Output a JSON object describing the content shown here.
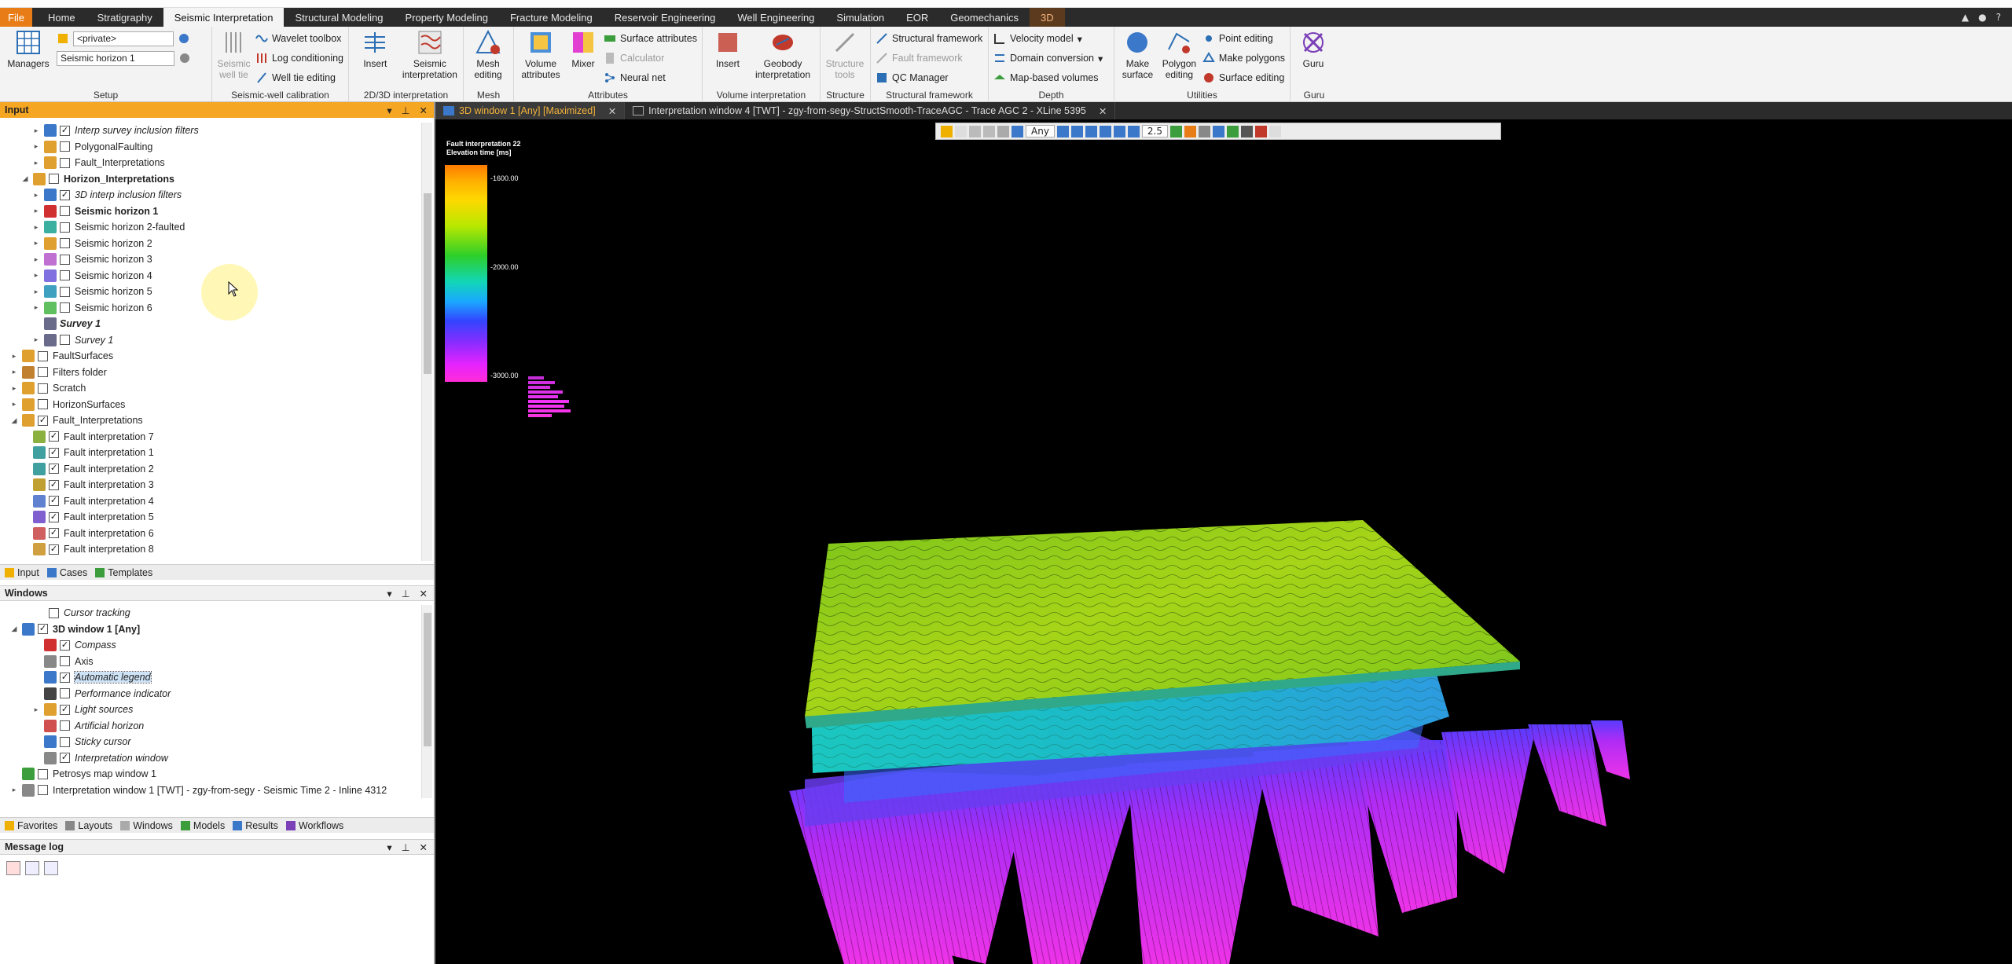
{
  "ribbon_tabs": [
    "File",
    "Home",
    "Stratigraphy",
    "Seismic Interpretation",
    "Structural Modeling",
    "Property Modeling",
    "Fracture Modeling",
    "Reservoir Engineering",
    "Well Engineering",
    "Simulation",
    "EOR",
    "Geomechanics",
    "3D"
  ],
  "active_tab": "Seismic Interpretation",
  "ribbon": {
    "setup": {
      "label": "Setup",
      "managers": "Managers",
      "private_combo": "<private>",
      "horizon_combo": "Seismic horizon 1"
    },
    "well_calibration": {
      "label": "Seismic-well calibration",
      "seismic_well_tie": "Seismic well tie",
      "wavelet_toolbox": "Wavelet toolbox",
      "log_conditioning": "Log conditioning",
      "well_tie_editing": "Well tie editing"
    },
    "interp_2d3d": {
      "label": "2D/3D interpretation",
      "insert": "Insert",
      "seismic_interpretation": "Seismic interpretation"
    },
    "mesh": {
      "label": "Mesh",
      "mesh_editing": "Mesh editing"
    },
    "attributes": {
      "label": "Attributes",
      "volume_attributes": "Volume attributes",
      "mixer": "Mixer",
      "surface_attributes": "Surface attributes",
      "calculator": "Calculator",
      "neural_net": "Neural net"
    },
    "volume_interp": {
      "label": "Volume interpretation",
      "insert": "Insert",
      "geobody_interpretation": "Geobody interpretation"
    },
    "structure": {
      "label": "Structure",
      "structure_tools": "Structure tools"
    },
    "structural_framework": {
      "label": "Structural framework",
      "structural_framework": "Structural framework",
      "fault_framework": "Fault framework",
      "qc_manager": "QC Manager"
    },
    "depth": {
      "label": "Depth",
      "velocity_model": "Velocity model",
      "domain_conversion": "Domain conversion",
      "map_based_volumes": "Map-based volumes"
    },
    "utilities": {
      "label": "Utilities",
      "make_surface": "Make surface",
      "polygon_editing": "Polygon editing",
      "point_editing": "Point editing",
      "make_polygons": "Make polygons",
      "surface_editing": "Surface editing"
    },
    "guru": {
      "label": "Guru",
      "guru": "Guru"
    }
  },
  "input_panel": {
    "title": "Input",
    "items": [
      {
        "label": "Interp survey inclusion filters",
        "checked": true,
        "style": "italic",
        "expand": "▸"
      },
      {
        "label": "PolygonalFaulting",
        "checked": false,
        "style": "normal",
        "expand": "▸"
      },
      {
        "label": "Fault_Interpretations",
        "checked": false,
        "style": "normal",
        "expand": "▸"
      },
      {
        "label": "Horizon_Interpretations",
        "checked": false,
        "style": "bold",
        "expand": "◢"
      },
      {
        "label": "3D interp inclusion filters",
        "checked": true,
        "style": "italic",
        "expand": "▸"
      },
      {
        "label": "Seismic horizon 1",
        "checked": false,
        "style": "bold",
        "expand": "▸"
      },
      {
        "label": "Seismic horizon 2-faulted",
        "checked": false,
        "style": "normal",
        "expand": "▸"
      },
      {
        "label": "Seismic horizon 2",
        "checked": false,
        "style": "normal",
        "expand": "▸"
      },
      {
        "label": "Seismic horizon 3",
        "checked": false,
        "style": "normal",
        "expand": "▸"
      },
      {
        "label": "Seismic horizon 4",
        "checked": false,
        "style": "normal",
        "expand": "▸"
      },
      {
        "label": "Seismic horizon 5",
        "checked": false,
        "style": "normal",
        "expand": "▸"
      },
      {
        "label": "Seismic horizon 6",
        "checked": false,
        "style": "normal",
        "expand": "▸"
      },
      {
        "label": "Survey 1",
        "checked": null,
        "style": "bold-italic",
        "expand": ""
      },
      {
        "label": "Survey 1",
        "checked": false,
        "style": "italic",
        "expand": "▸"
      },
      {
        "label": "FaultSurfaces",
        "checked": false,
        "style": "normal",
        "expand": "▸"
      },
      {
        "label": "Filters folder",
        "checked": false,
        "style": "normal",
        "expand": "▸"
      },
      {
        "label": "Scratch",
        "checked": false,
        "style": "normal",
        "expand": "▸"
      },
      {
        "label": "HorizonSurfaces",
        "checked": false,
        "style": "normal",
        "expand": "▸"
      },
      {
        "label": "Fault_Interpretations",
        "checked": true,
        "style": "normal",
        "expand": "◢"
      },
      {
        "label": "Fault interpretation 7",
        "checked": true,
        "style": "normal",
        "expand": ""
      },
      {
        "label": "Fault interpretation 1",
        "checked": true,
        "style": "normal",
        "expand": ""
      },
      {
        "label": "Fault interpretation 2",
        "checked": true,
        "style": "normal",
        "expand": ""
      },
      {
        "label": "Fault interpretation 3",
        "checked": true,
        "style": "normal",
        "expand": ""
      },
      {
        "label": "Fault interpretation 4",
        "checked": true,
        "style": "normal",
        "expand": ""
      },
      {
        "label": "Fault interpretation 5",
        "checked": true,
        "style": "normal",
        "expand": ""
      },
      {
        "label": "Fault interpretation 6",
        "checked": true,
        "style": "normal",
        "expand": ""
      },
      {
        "label": "Fault interpretation 8",
        "checked": true,
        "style": "normal",
        "expand": ""
      }
    ]
  },
  "input_bottom_tabs": [
    "Input",
    "Cases",
    "Templates"
  ],
  "windows_panel": {
    "title": "Windows",
    "items": [
      {
        "label": "Cursor tracking",
        "checked": false,
        "style": "italic",
        "expand": ""
      },
      {
        "label": "3D window 1 [Any]",
        "checked": true,
        "style": "bold",
        "expand": "◢"
      },
      {
        "label": "Compass",
        "checked": true,
        "style": "italic",
        "expand": ""
      },
      {
        "label": "Axis",
        "checked": false,
        "style": "normal",
        "expand": ""
      },
      {
        "label": "Automatic legend",
        "checked": true,
        "style": "italic-selected",
        "expand": ""
      },
      {
        "label": "Performance indicator",
        "checked": false,
        "style": "italic",
        "expand": ""
      },
      {
        "label": "Light sources",
        "checked": true,
        "style": "italic",
        "expand": "▸"
      },
      {
        "label": "Artificial horizon",
        "checked": false,
        "style": "italic",
        "expand": ""
      },
      {
        "label": "Sticky cursor",
        "checked": false,
        "style": "italic",
        "expand": ""
      },
      {
        "label": "Interpretation window",
        "checked": true,
        "style": "italic",
        "expand": ""
      },
      {
        "label": "Petrosys map window 1",
        "checked": false,
        "style": "normal",
        "expand": ""
      },
      {
        "label": "Interpretation window 1 [TWT] - zgy-from-segy - Seismic Time 2 - Inline 4312",
        "checked": false,
        "style": "normal",
        "expand": "▸"
      }
    ]
  },
  "windows_bottom_tabs": [
    "Favorites",
    "Layouts",
    "Windows",
    "Models",
    "Results",
    "Workflows"
  ],
  "message_log": {
    "title": "Message log"
  },
  "window_tabs": [
    {
      "label": "3D window 1 [Any] [Maximized]",
      "active": true
    },
    {
      "label": "Interpretation window 4 [TWT] - zgy-from-segy-StructSmooth-TraceAGC - Trace AGC 2 - XLine 5395",
      "active": false
    }
  ],
  "viewport": {
    "toolbar_domain": "Any",
    "toolbar_zscale": "2.5",
    "legend_title": "Fault interpretation 22",
    "legend_subtitle": "Elevation time [ms]",
    "legend_ticks": [
      "-1600.00",
      "-2000.00",
      "-3000.00"
    ],
    "legend_tick_fracs": [
      0.06,
      0.47,
      0.97
    ]
  },
  "colors": {
    "file_tab": "#e87c16",
    "panel_header": "#f5a623",
    "tab_bar": "#2b2b2b",
    "active_window_tab_text": "#f2b23a",
    "viewport_bg": "#000000",
    "horizon_upper": "#8ccb1a",
    "horizon_lower": "#1bb9c9",
    "faults": "#e633e6"
  }
}
